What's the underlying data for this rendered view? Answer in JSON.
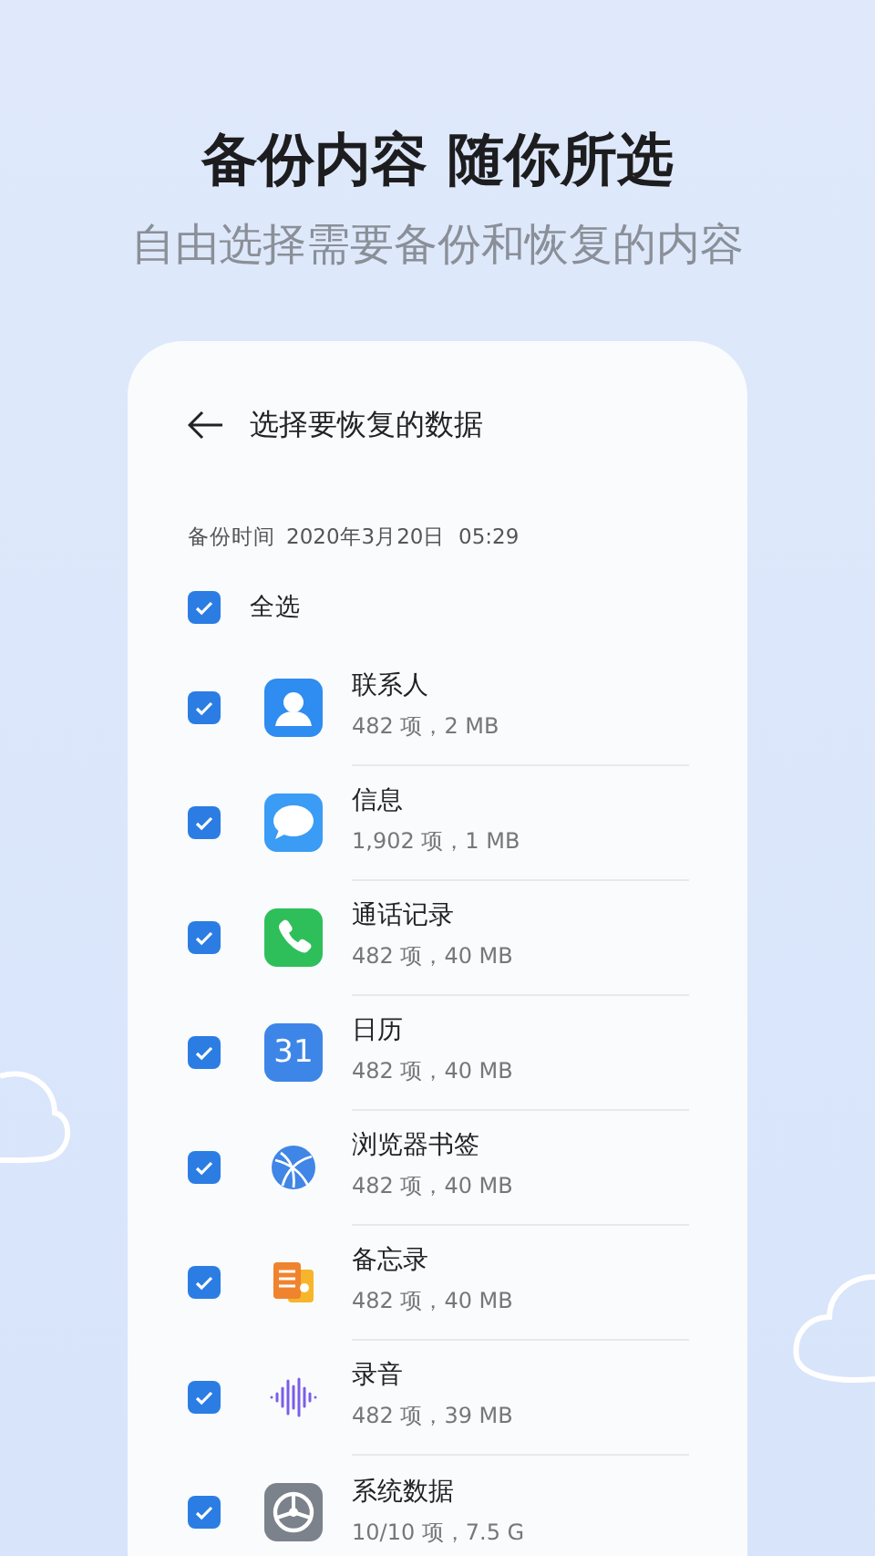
{
  "headline": "备份内容 随你所选",
  "subheadline": "自由选择需要备份和恢复的内容",
  "screen": {
    "title": "选择要恢复的数据",
    "backup_time_label": "备份时间",
    "backup_time": "2020年3月20日  05:29",
    "select_all": {
      "label": "全选",
      "checked": true
    },
    "items": [
      {
        "kind": "contacts",
        "name": "联系人",
        "detail": "482 项，2 MB",
        "checked": true
      },
      {
        "kind": "messages",
        "name": "信息",
        "detail": "1,902 项，1 MB",
        "checked": true
      },
      {
        "kind": "phone",
        "name": "通话记录",
        "detail": "482 项，40 MB",
        "checked": true
      },
      {
        "kind": "calendar",
        "icon_text": "31",
        "name": "日历",
        "detail": "482 项，40 MB",
        "checked": true
      },
      {
        "kind": "browser",
        "name": "浏览器书签",
        "detail": "482 项，40 MB",
        "checked": true
      },
      {
        "kind": "notes",
        "name": "备忘录",
        "detail": "482 项，40 MB",
        "checked": true
      },
      {
        "kind": "recorder",
        "name": "录音",
        "detail": "482 项，39 MB",
        "checked": true
      },
      {
        "kind": "system",
        "name": "系统数据",
        "detail": "10/10 项，7.5 G",
        "checked": true
      }
    ]
  }
}
